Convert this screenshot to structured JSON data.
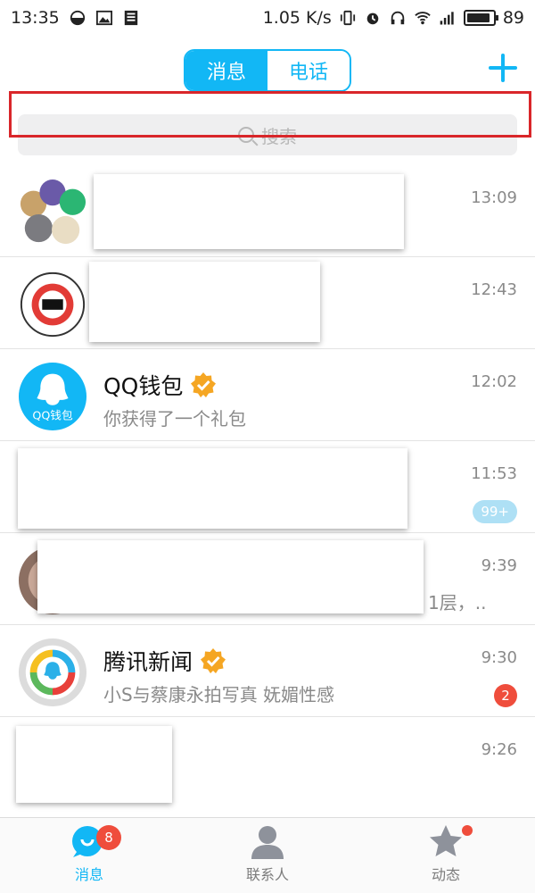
{
  "status_bar": {
    "time": "13:35",
    "speed": "1.05 K/s",
    "battery": "89",
    "battery_level": 0.89,
    "icons": [
      "half-circle-icon",
      "image-icon",
      "news-icon",
      "vibrate-icon",
      "alarm-icon",
      "headphones-icon",
      "wifi-icon",
      "signal-4g-icon",
      "battery-icon"
    ]
  },
  "header": {
    "tabs": [
      {
        "label": "消息",
        "active": true
      },
      {
        "label": "电话",
        "active": false
      }
    ],
    "plus_icon": "plus-icon"
  },
  "search": {
    "placeholder": "搜索"
  },
  "conversations": [
    {
      "time": "13:09",
      "redacted": true
    },
    {
      "time": "12:43",
      "redacted": true
    },
    {
      "title": "QQ钱包",
      "verified": true,
      "subtitle": "你获得了一个礼包",
      "time": "12:02"
    },
    {
      "time": "11:53",
      "badge": "99+",
      "redacted": true
    },
    {
      "time": "9:39",
      "subtitle_tail": "1层，..",
      "redacted": true
    },
    {
      "title": "腾讯新闻",
      "verified": true,
      "subtitle": "小S与蔡康永拍写真 妩媚性感",
      "time": "9:30",
      "badge": "2"
    },
    {
      "time": "9:26",
      "redacted": true
    }
  ],
  "avatar_labels": {
    "qq_wallet": "QQ钱包"
  },
  "tabbar": {
    "tabs": [
      {
        "label": "消息",
        "badge": "8",
        "icon": "message-icon",
        "active": true
      },
      {
        "label": "联系人",
        "icon": "contacts-icon",
        "active": false
      },
      {
        "label": "动态",
        "icon": "star-icon",
        "dot": true,
        "active": false
      }
    ]
  },
  "colors": {
    "accent": "#12b7f5",
    "badge_red": "#ef4d3c",
    "highlight_box": "#d9262a",
    "verified": "#f5a623"
  }
}
